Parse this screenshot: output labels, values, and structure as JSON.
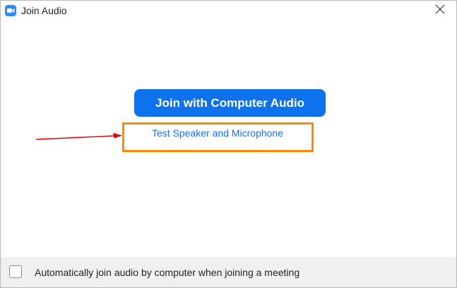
{
  "window": {
    "title": "Join Audio",
    "app_icon": "video-camera-icon",
    "close_icon": "close-icon"
  },
  "main": {
    "join_button_label": "Join with Computer Audio",
    "test_link_label": "Test Speaker and Microphone"
  },
  "footer": {
    "auto_join_label": "Automatically join audio by computer when joining a meeting",
    "auto_join_checked": false
  },
  "colors": {
    "accent": "#0e72ed",
    "highlight": "#ff8a00",
    "annotation_arrow": "#e00000",
    "footer_bg": "#f0f0f0"
  }
}
